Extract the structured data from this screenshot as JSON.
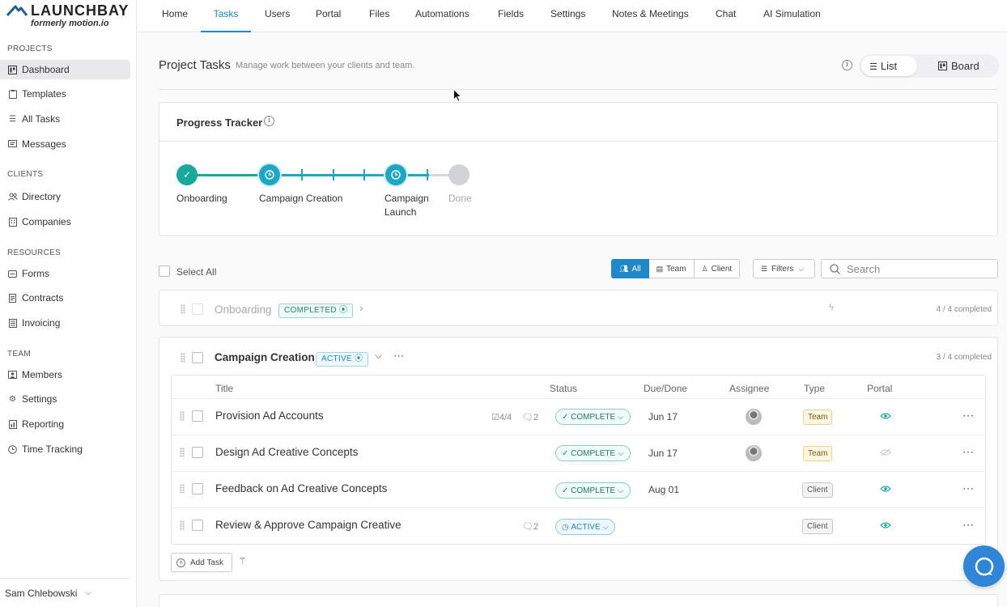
{
  "brand": {
    "name": "LAUNCHBAY",
    "tagline": "formerly motion.io"
  },
  "sidebar": {
    "sections": [
      {
        "title": "PROJECTS",
        "items": [
          {
            "label": "Dashboard",
            "icon": "dashboard-icon"
          },
          {
            "label": "Templates",
            "icon": "template-icon"
          },
          {
            "label": "All Tasks",
            "icon": "list-icon"
          },
          {
            "label": "Messages",
            "icon": "messages-icon"
          }
        ]
      },
      {
        "title": "CLIENTS",
        "items": [
          {
            "label": "Directory",
            "icon": "people-icon"
          },
          {
            "label": "Companies",
            "icon": "building-icon"
          }
        ]
      },
      {
        "title": "RESOURCES",
        "items": [
          {
            "label": "Forms",
            "icon": "form-icon"
          },
          {
            "label": "Contracts",
            "icon": "contract-icon"
          },
          {
            "label": "Invoicing",
            "icon": "invoice-icon"
          }
        ]
      },
      {
        "title": "TEAM",
        "items": [
          {
            "label": "Members",
            "icon": "members-icon"
          },
          {
            "label": "Settings",
            "icon": "gear-icon"
          },
          {
            "label": "Reporting",
            "icon": "report-icon"
          },
          {
            "label": "Time Tracking",
            "icon": "clock-icon"
          }
        ]
      }
    ],
    "user": "Sam Chlebowski"
  },
  "topnav": [
    "Home",
    "Tasks",
    "Users",
    "Portal",
    "Files",
    "Automations",
    "Fields",
    "Settings",
    "Notes & Meetings",
    "Chat",
    "AI Simulation"
  ],
  "page": {
    "title": "Project Tasks",
    "subtitle": "Manage work between your clients and team.",
    "view_list": "List",
    "view_board": "Board"
  },
  "tracker": {
    "title": "Progress Tracker",
    "milestones": [
      {
        "label": "Onboarding",
        "state": "completed"
      },
      {
        "label": "Campaign Creation",
        "state": "active"
      },
      {
        "label": "Campaign Launch",
        "label_line1": "Campaign",
        "label_line2": "Launch",
        "state": "active"
      },
      {
        "label": "Done",
        "state": "pending"
      }
    ]
  },
  "toolbar": {
    "select_all": "Select All",
    "filter_all": "All",
    "filter_team": "Team",
    "filter_client": "Client",
    "filters": "Filters",
    "search_placeholder": "Search"
  },
  "groups": {
    "onboarding": {
      "name": "Onboarding",
      "status": "COMPLETED",
      "count": "4 / 4 completed"
    },
    "campaign": {
      "name": "Campaign Creation",
      "status": "ACTIVE",
      "count": "3 / 4 completed"
    }
  },
  "table": {
    "headers": {
      "title": "Title",
      "status": "Status",
      "due": "Due/Done",
      "assignee": "Assignee",
      "type": "Type",
      "portal": "Portal"
    },
    "rows": [
      {
        "title": "Provision Ad Accounts",
        "checklist": "4/4",
        "comments": "2",
        "status": "COMPLETE",
        "due": "Jun 17",
        "type": "Team"
      },
      {
        "title": "Design Ad Creative Concepts",
        "status": "COMPLETE",
        "due": "Jun 17",
        "type": "Team"
      },
      {
        "title": "Feedback on Ad Creative Concepts",
        "status": "COMPLETE",
        "due": "Aug 01",
        "type": "Client"
      },
      {
        "title": "Review & Approve Campaign Creative",
        "comments": "2",
        "status": "ACTIVE",
        "due": "",
        "type": "Client"
      }
    ],
    "add_task": "Add Task"
  },
  "colors": {
    "accent": "#1e88c8",
    "teal": "#1aa89a",
    "progress": "#1ea7c4",
    "help": "#2f86d6"
  }
}
